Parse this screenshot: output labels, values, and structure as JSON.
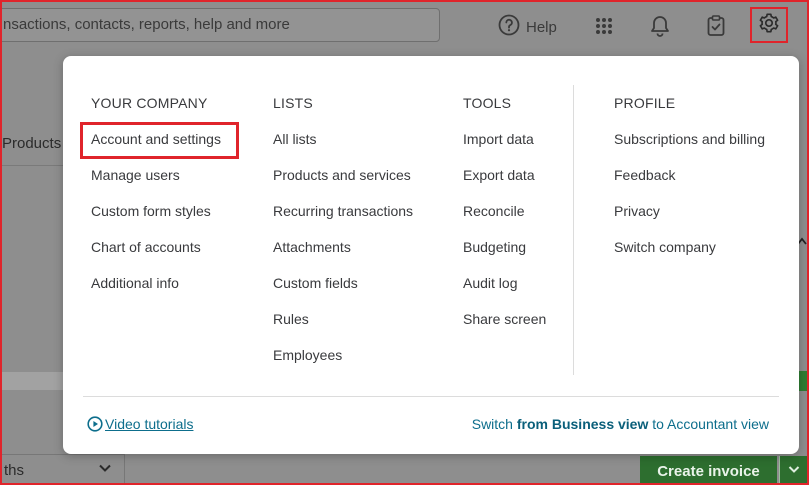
{
  "header": {
    "search_text": "nsactions, contacts, reports, help and more",
    "help_label": "Help"
  },
  "background": {
    "products_tab": "Products",
    "filter_text": "ths",
    "create_invoice": "Create invoice"
  },
  "menu": {
    "columns": [
      {
        "heading": "YOUR COMPANY",
        "items": [
          "Account and settings",
          "Manage users",
          "Custom form styles",
          "Chart of accounts",
          "Additional info"
        ]
      },
      {
        "heading": "LISTS",
        "items": [
          "All lists",
          "Products and services",
          "Recurring transactions",
          "Attachments",
          "Custom fields",
          "Rules",
          "Employees"
        ]
      },
      {
        "heading": "TOOLS",
        "items": [
          "Import data",
          "Export data",
          "Reconcile",
          "Budgeting",
          "Audit log",
          "Share screen"
        ]
      },
      {
        "heading": "PROFILE",
        "items": [
          "Subscriptions and billing",
          "Feedback",
          "Privacy",
          "Switch company"
        ]
      }
    ],
    "footer": {
      "video_tutorials": "Video tutorials",
      "switch_prefix": "Switch ",
      "switch_bold": "from Business view",
      "switch_suffix": " to Accountant view"
    }
  },
  "colors": {
    "highlight": "#e0242b",
    "link": "#0d6e8c",
    "primary_green": "#2d6e2f"
  },
  "icons": [
    "help-circle-icon",
    "apps-grid-icon",
    "bell-icon",
    "clipboard-check-icon",
    "gear-icon",
    "play-circle-icon",
    "chevron-down-icon"
  ]
}
